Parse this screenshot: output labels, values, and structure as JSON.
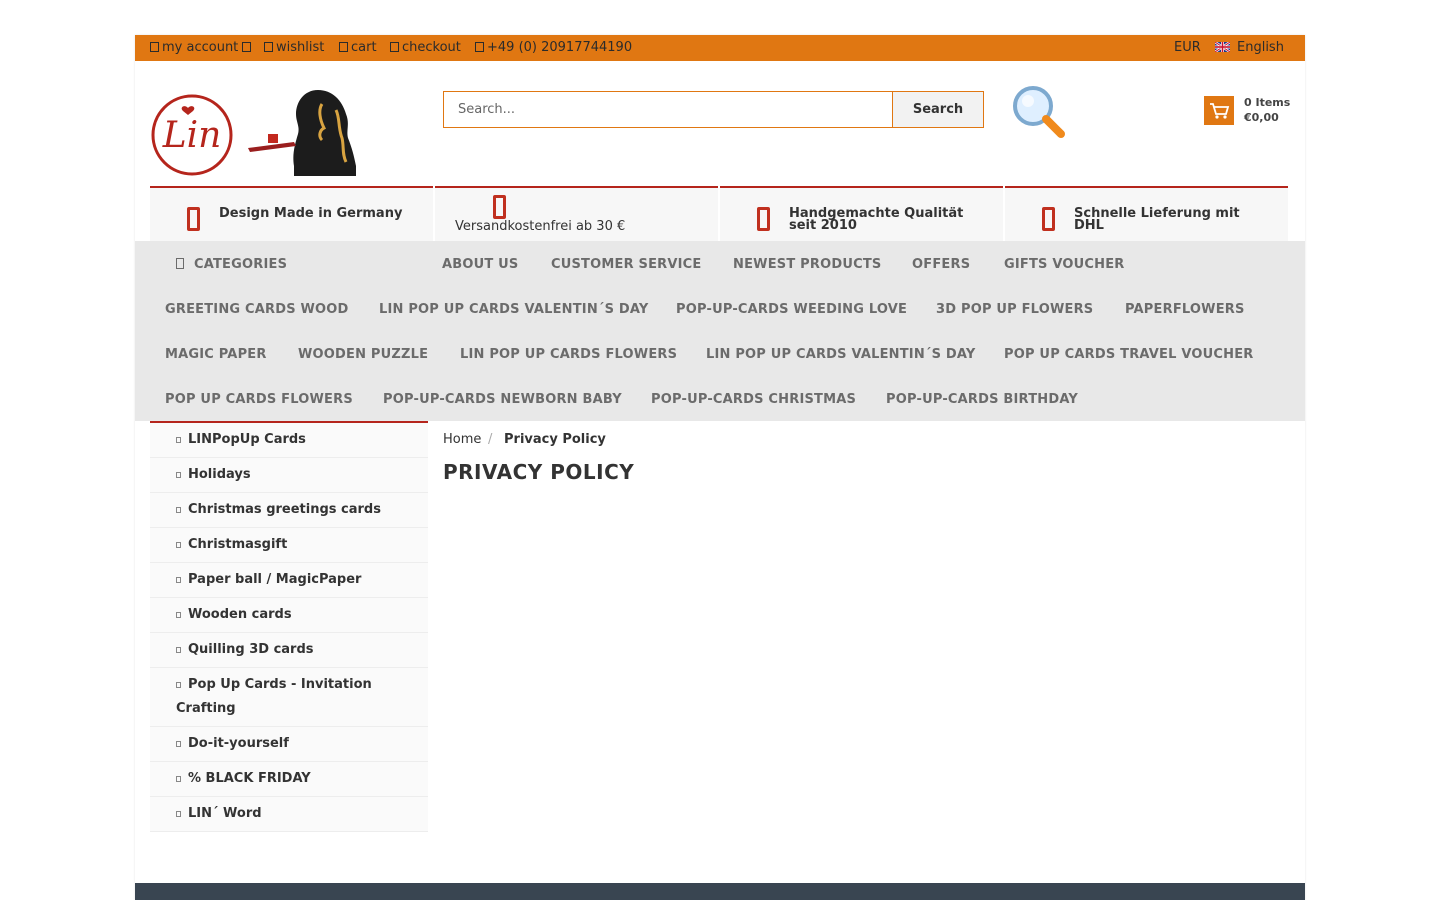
{
  "topbar": {
    "links": [
      {
        "icon": "user-icon",
        "label": "my account"
      },
      {
        "icon": "heart-icon",
        "label": "wishlist"
      },
      {
        "icon": "cart-icon",
        "label": "cart"
      },
      {
        "icon": "share-icon",
        "label": "checkout"
      },
      {
        "icon": "phone-icon",
        "label": "+49 (0) 20917744190"
      }
    ],
    "currency": "EUR",
    "language": "English",
    "caret_icon": "caret-down-icon"
  },
  "header": {
    "logo_text": "Lin",
    "search": {
      "placeholder": "Search...",
      "button": "Search"
    },
    "magnifier_icon": "magnifier-icon",
    "cart": {
      "items": "0 Items",
      "total": "€0,00"
    }
  },
  "features": [
    {
      "icon": "germany-icon",
      "text": "Design Made in Germany"
    },
    {
      "icon": "truck-icon",
      "text": "Versandkostenfrei ab 30 €"
    },
    {
      "icon": "hand-icon",
      "line1": "Handgemachte Qualität",
      "line2": "seit 2010"
    },
    {
      "icon": "delivery-icon",
      "line1": "Schnelle Lieferung mit",
      "line2": "DHL"
    }
  ],
  "nav": {
    "categories": "CATEGORIES",
    "row1": [
      "ABOUT US",
      "CUSTOMER SERVICE",
      "NEWEST PRODUCTS",
      "OFFERS",
      "GIFTS VOUCHER"
    ],
    "row2": [
      "GREETING CARDS WOOD",
      "LIN POP UP CARDS VALENTIN´S DAY",
      "POP-UP-CARDS WEEDING LOVE",
      "3D POP UP FLOWERS",
      "PAPERFLOWERS"
    ],
    "row3": [
      "MAGIC PAPER",
      "WOODEN PUZZLE",
      "LIN POP UP CARDS FLOWERS",
      "LIN POP UP CARDS VALENTIN´S DAY",
      "POP UP CARDS TRAVEL VOUCHER"
    ],
    "row4": [
      "POP UP CARDS FLOWERS",
      "POP-UP-CARDS NEWBORN BABY",
      "POP-UP-CARDS CHRISTMAS",
      "POP-UP-CARDS BIRTHDAY"
    ]
  },
  "sidebar": {
    "items": [
      "LINPopUp Cards",
      "Holidays",
      "Christmas greetings cards",
      "Christmasgift",
      "Paper ball / MagicPaper",
      "Wooden cards",
      "Quilling 3D cards",
      "Pop Up Cards - Invitation",
      "Do-it-yourself",
      "% BLACK FRIDAY",
      "LIN´ Word"
    ],
    "item7_line2": "Crafting"
  },
  "breadcrumb": {
    "home": "Home",
    "sep": "/",
    "current": "Privacy Policy"
  },
  "page_title": "PRIVACY POLICY",
  "colors": {
    "accent": "#e07712",
    "brand_red": "#b5251c",
    "nav_bg": "#e8e8e8",
    "footer": "#394551"
  }
}
